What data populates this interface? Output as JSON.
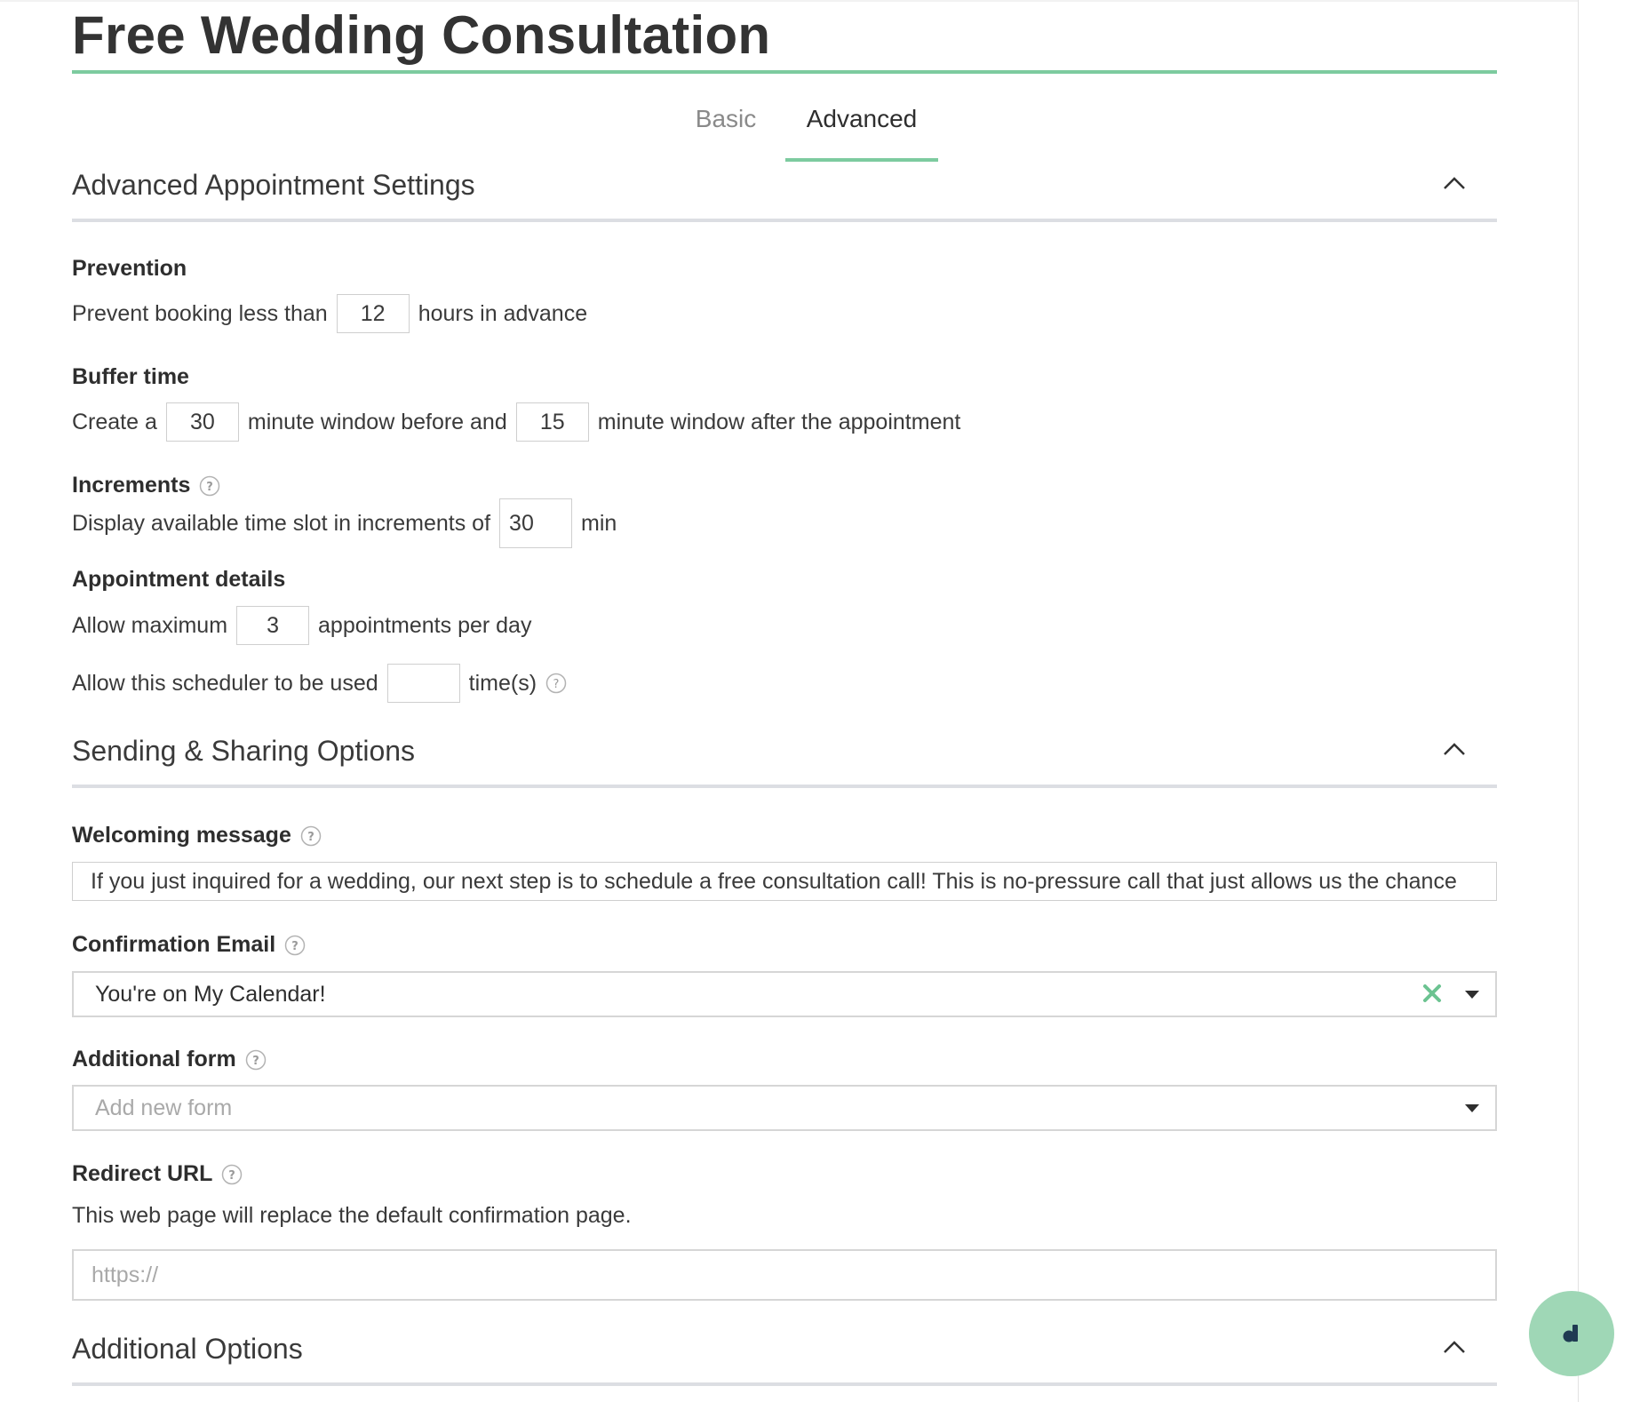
{
  "page": {
    "title": "Free Wedding Consultation",
    "accent_color": "#7dcb9f"
  },
  "tabs": [
    {
      "label": "Basic",
      "active": false
    },
    {
      "label": "Advanced",
      "active": true
    }
  ],
  "advanced_settings": {
    "title": "Advanced Appointment Settings",
    "prevention": {
      "label": "Prevention",
      "prefix": "Prevent booking less than",
      "value": "12",
      "suffix": "hours in advance"
    },
    "buffer": {
      "label": "Buffer time",
      "prefix": "Create a",
      "before_value": "30",
      "middle": "minute window before and",
      "after_value": "15",
      "suffix": "minute window after the appointment"
    },
    "increments": {
      "label": "Increments",
      "prefix": "Display available time slot in increments of",
      "value": "30",
      "suffix": "min"
    },
    "appointment_details": {
      "label": "Appointment details",
      "max_prefix": "Allow maximum",
      "max_value": "3",
      "max_suffix": "appointments per day",
      "uses_prefix": "Allow this scheduler to be used",
      "uses_value": "",
      "uses_suffix": "time(s)"
    }
  },
  "sending": {
    "title": "Sending & Sharing Options",
    "welcome": {
      "label": "Welcoming message",
      "value": "If you just inquired for a wedding, our next step is to schedule a free consultation call! This is no-pressure call that just allows us the chance"
    },
    "confirmation": {
      "label": "Confirmation Email",
      "value": "You're on My Calendar!"
    },
    "additional_form": {
      "label": "Additional form",
      "placeholder": "Add new form"
    },
    "redirect": {
      "label": "Redirect URL",
      "description": "This web page will replace the default confirmation page.",
      "placeholder": "https://"
    }
  },
  "additional_options": {
    "title": "Additional Options"
  },
  "icons": {
    "chevron": "chevron-up-icon",
    "help": "question-circle-icon",
    "clear": "close-x-icon",
    "caret": "caret-down-icon",
    "fab": "dubsado-logo-icon"
  }
}
